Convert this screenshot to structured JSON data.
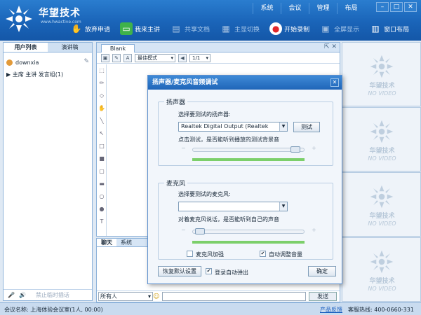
{
  "app": {
    "brand": "华望技术",
    "brand_sub": "www.hwactive.com",
    "menu": [
      "系统",
      "会议",
      "管理",
      "布局"
    ],
    "window_buttons": [
      "–",
      "□",
      "✕"
    ],
    "toolbar": [
      {
        "label": "放弃申请",
        "icon": "hand-icon",
        "dim": false
      },
      {
        "label": "我来主讲",
        "icon": "presenter-icon",
        "dim": false
      },
      {
        "label": "共享文档",
        "icon": "share-doc-icon",
        "dim": true
      },
      {
        "label": "主显切换",
        "icon": "switch-display-icon",
        "dim": true
      },
      {
        "label": "开始录制",
        "icon": "record-icon",
        "dim": false
      },
      {
        "label": "全屏显示",
        "icon": "fullscreen-icon",
        "dim": true
      },
      {
        "label": "窗口布局",
        "icon": "window-layout-icon",
        "dim": false
      }
    ]
  },
  "left_panel": {
    "tabs": [
      "用户列表",
      "演讲稿"
    ],
    "user": "downxia",
    "group": "▶ 主席 主讲 发言组(1)",
    "footer_icons": [
      "🎤",
      "🔊"
    ],
    "footer_action": "禁止临时插话"
  },
  "whiteboard": {
    "tab": "Blank",
    "zoom_mode": "最佳模式",
    "page": "1/1",
    "controls": "⇱ ✕"
  },
  "chat": {
    "tabs": [
      "聊天",
      "系统"
    ],
    "recipient": "所有人",
    "send_label": "发送"
  },
  "video": {
    "brand": "华望技术",
    "no_video": "NO VIDEO",
    "count": 4
  },
  "status": {
    "conference": "会议名称: 上海体验会议室(1人, 00:00)",
    "feedback": "产品反馈",
    "hotline": "客服热线: 400-0660-331"
  },
  "dialog": {
    "title": "扬声器/麦克风音频调试",
    "close": "✕",
    "speaker_group": "扬声器",
    "speaker_prompt": "选择要测试的扬声器:",
    "speaker_device": "Realtek Digital Output (Realtek",
    "test_button": "测试",
    "speaker_hint": "点击测试，是否能听到播放的测试背景音",
    "speaker_volume": 0.95,
    "speaker_level": 1.0,
    "mic_group": "麦克风",
    "mic_prompt": "选择要测试的麦克风:",
    "mic_device": "",
    "mic_hint": "对着麦克风说话，是否能听到自己的声音",
    "mic_volume": 0.02,
    "mic_level": 1.0,
    "mic_boost_label": "麦克风加强",
    "mic_boost": false,
    "auto_gain_label": "自动调整音量",
    "auto_gain": true,
    "restore_button": "恢复默认设置",
    "auto_exit_label": "登录自动弹出",
    "auto_exit": true,
    "ok_button": "确定"
  }
}
